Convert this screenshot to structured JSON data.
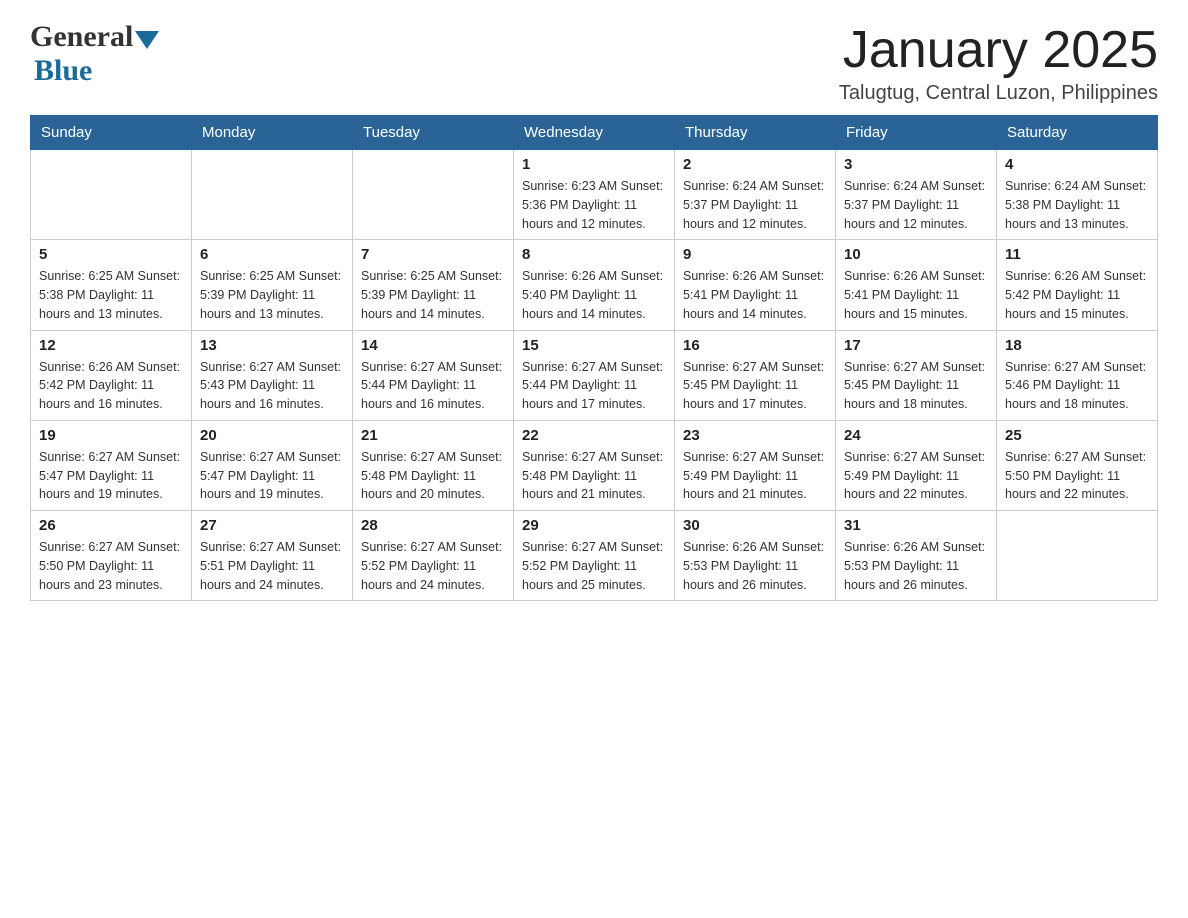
{
  "header": {
    "logo": {
      "general": "General",
      "blue": "Blue"
    },
    "title": "January 2025",
    "location": "Talugtug, Central Luzon, Philippines"
  },
  "calendar": {
    "headers": [
      "Sunday",
      "Monday",
      "Tuesday",
      "Wednesday",
      "Thursday",
      "Friday",
      "Saturday"
    ],
    "weeks": [
      [
        {
          "day": "",
          "info": ""
        },
        {
          "day": "",
          "info": ""
        },
        {
          "day": "",
          "info": ""
        },
        {
          "day": "1",
          "info": "Sunrise: 6:23 AM\nSunset: 5:36 PM\nDaylight: 11 hours\nand 12 minutes."
        },
        {
          "day": "2",
          "info": "Sunrise: 6:24 AM\nSunset: 5:37 PM\nDaylight: 11 hours\nand 12 minutes."
        },
        {
          "day": "3",
          "info": "Sunrise: 6:24 AM\nSunset: 5:37 PM\nDaylight: 11 hours\nand 12 minutes."
        },
        {
          "day": "4",
          "info": "Sunrise: 6:24 AM\nSunset: 5:38 PM\nDaylight: 11 hours\nand 13 minutes."
        }
      ],
      [
        {
          "day": "5",
          "info": "Sunrise: 6:25 AM\nSunset: 5:38 PM\nDaylight: 11 hours\nand 13 minutes."
        },
        {
          "day": "6",
          "info": "Sunrise: 6:25 AM\nSunset: 5:39 PM\nDaylight: 11 hours\nand 13 minutes."
        },
        {
          "day": "7",
          "info": "Sunrise: 6:25 AM\nSunset: 5:39 PM\nDaylight: 11 hours\nand 14 minutes."
        },
        {
          "day": "8",
          "info": "Sunrise: 6:26 AM\nSunset: 5:40 PM\nDaylight: 11 hours\nand 14 minutes."
        },
        {
          "day": "9",
          "info": "Sunrise: 6:26 AM\nSunset: 5:41 PM\nDaylight: 11 hours\nand 14 minutes."
        },
        {
          "day": "10",
          "info": "Sunrise: 6:26 AM\nSunset: 5:41 PM\nDaylight: 11 hours\nand 15 minutes."
        },
        {
          "day": "11",
          "info": "Sunrise: 6:26 AM\nSunset: 5:42 PM\nDaylight: 11 hours\nand 15 minutes."
        }
      ],
      [
        {
          "day": "12",
          "info": "Sunrise: 6:26 AM\nSunset: 5:42 PM\nDaylight: 11 hours\nand 16 minutes."
        },
        {
          "day": "13",
          "info": "Sunrise: 6:27 AM\nSunset: 5:43 PM\nDaylight: 11 hours\nand 16 minutes."
        },
        {
          "day": "14",
          "info": "Sunrise: 6:27 AM\nSunset: 5:44 PM\nDaylight: 11 hours\nand 16 minutes."
        },
        {
          "day": "15",
          "info": "Sunrise: 6:27 AM\nSunset: 5:44 PM\nDaylight: 11 hours\nand 17 minutes."
        },
        {
          "day": "16",
          "info": "Sunrise: 6:27 AM\nSunset: 5:45 PM\nDaylight: 11 hours\nand 17 minutes."
        },
        {
          "day": "17",
          "info": "Sunrise: 6:27 AM\nSunset: 5:45 PM\nDaylight: 11 hours\nand 18 minutes."
        },
        {
          "day": "18",
          "info": "Sunrise: 6:27 AM\nSunset: 5:46 PM\nDaylight: 11 hours\nand 18 minutes."
        }
      ],
      [
        {
          "day": "19",
          "info": "Sunrise: 6:27 AM\nSunset: 5:47 PM\nDaylight: 11 hours\nand 19 minutes."
        },
        {
          "day": "20",
          "info": "Sunrise: 6:27 AM\nSunset: 5:47 PM\nDaylight: 11 hours\nand 19 minutes."
        },
        {
          "day": "21",
          "info": "Sunrise: 6:27 AM\nSunset: 5:48 PM\nDaylight: 11 hours\nand 20 minutes."
        },
        {
          "day": "22",
          "info": "Sunrise: 6:27 AM\nSunset: 5:48 PM\nDaylight: 11 hours\nand 21 minutes."
        },
        {
          "day": "23",
          "info": "Sunrise: 6:27 AM\nSunset: 5:49 PM\nDaylight: 11 hours\nand 21 minutes."
        },
        {
          "day": "24",
          "info": "Sunrise: 6:27 AM\nSunset: 5:49 PM\nDaylight: 11 hours\nand 22 minutes."
        },
        {
          "day": "25",
          "info": "Sunrise: 6:27 AM\nSunset: 5:50 PM\nDaylight: 11 hours\nand 22 minutes."
        }
      ],
      [
        {
          "day": "26",
          "info": "Sunrise: 6:27 AM\nSunset: 5:50 PM\nDaylight: 11 hours\nand 23 minutes."
        },
        {
          "day": "27",
          "info": "Sunrise: 6:27 AM\nSunset: 5:51 PM\nDaylight: 11 hours\nand 24 minutes."
        },
        {
          "day": "28",
          "info": "Sunrise: 6:27 AM\nSunset: 5:52 PM\nDaylight: 11 hours\nand 24 minutes."
        },
        {
          "day": "29",
          "info": "Sunrise: 6:27 AM\nSunset: 5:52 PM\nDaylight: 11 hours\nand 25 minutes."
        },
        {
          "day": "30",
          "info": "Sunrise: 6:26 AM\nSunset: 5:53 PM\nDaylight: 11 hours\nand 26 minutes."
        },
        {
          "day": "31",
          "info": "Sunrise: 6:26 AM\nSunset: 5:53 PM\nDaylight: 11 hours\nand 26 minutes."
        },
        {
          "day": "",
          "info": ""
        }
      ]
    ]
  }
}
